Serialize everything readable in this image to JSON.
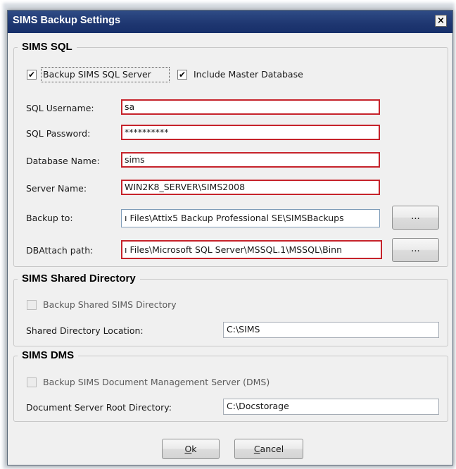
{
  "window": {
    "title": "SIMS Backup Settings",
    "close_glyph": "×"
  },
  "sql": {
    "group_title": "SIMS SQL",
    "backup_server": {
      "label": "Backup SIMS SQL Server",
      "checked": true,
      "mark": "✔"
    },
    "include_master": {
      "label": "Include Master Database",
      "checked": true,
      "mark": "✔"
    },
    "username_label": "SQL Username:",
    "username_value": "sa",
    "password_label": "SQL Password:",
    "password_value": "**********",
    "dbname_label": "Database Name:",
    "dbname_value": "sims",
    "server_label": "Server Name:",
    "server_value": "WIN2K8_SERVER\\SIMS2008",
    "backup_to_label": "Backup to:",
    "backup_to_value": "ı Files\\Attix5 Backup Professional SE\\SIMSBackups",
    "dbattach_label": "DBAttach path:",
    "dbattach_value": "ı Files\\Microsoft SQL Server\\MSSQL.1\\MSSQL\\Binn",
    "browse_label": "..."
  },
  "shared": {
    "group_title": "SIMS Shared Directory",
    "backup_label": "Backup Shared SIMS Directory",
    "checked": false,
    "location_label": "Shared Directory Location:",
    "location_value": "C:\\SIMS"
  },
  "dms": {
    "group_title": "SIMS DMS",
    "backup_label": "Backup SIMS Document Management Server (DMS)",
    "checked": false,
    "root_label": "Document Server Root Directory:",
    "root_value": "C:\\Docstorage"
  },
  "buttons": {
    "ok_accel": "O",
    "ok_rest": "k",
    "cancel_accel": "C",
    "cancel_rest": "ancel"
  },
  "colors": {
    "titlebar": "#1e3670",
    "highlight_border": "#c6232b",
    "dialog_bg": "#f0f0f0"
  }
}
